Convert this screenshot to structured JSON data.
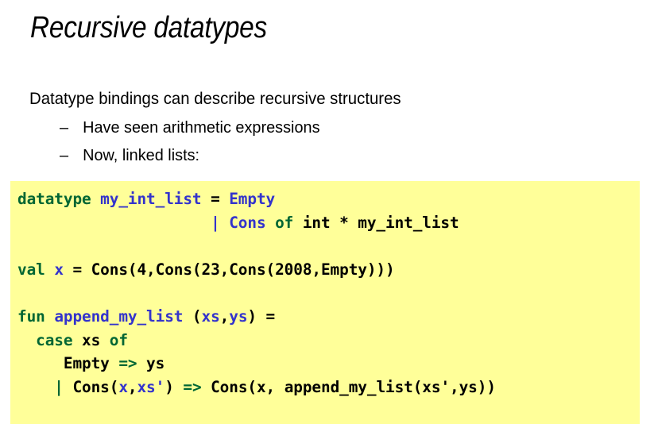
{
  "slide": {
    "title": "Recursive datatypes",
    "background_color": "#ffffff",
    "title_color": "#000000"
  },
  "bullets": {
    "level1": "Datatype bindings can describe recursive structures",
    "dash": "–",
    "level2": [
      "Have seen arithmetic expressions",
      "Now, linked lists:"
    ]
  },
  "code_block": {
    "background_color": "#ffff99",
    "keyword_color": "#006633",
    "constructor_color": "#3333cc",
    "plain_color": "#000000",
    "language": "Standard ML",
    "plain_text": "datatype my_int_list = Empty\n                     | Cons of int * my_int_list\n\nval x = Cons(4,Cons(23,Cons(2008,Empty)))\n\nfun append_my_list (xs,ys) =\n  case xs of\n     Empty => ys\n    | Cons(x,xs') => Cons(x, append_my_list(xs',ys))",
    "lines": [
      {
        "id": "line-datatype",
        "tokens": [
          {
            "text": "datatype",
            "style": "kw"
          },
          {
            "text": " ",
            "style": "plain"
          },
          {
            "text": "my_int_list",
            "style": "ctor"
          },
          {
            "text": " = ",
            "style": "plain"
          },
          {
            "text": "Empty",
            "style": "ctor"
          }
        ]
      },
      {
        "id": "line-cons-of",
        "tokens": [
          {
            "text": "                     ",
            "style": "plain"
          },
          {
            "text": "|",
            "style": "ctor"
          },
          {
            "text": " ",
            "style": "plain"
          },
          {
            "text": "Cons",
            "style": "ctor"
          },
          {
            "text": " ",
            "style": "plain"
          },
          {
            "text": "of",
            "style": "kw"
          },
          {
            "text": " int * my_int_list",
            "style": "plain"
          }
        ]
      },
      {
        "id": "line-blank-1",
        "tokens": []
      },
      {
        "id": "line-val-x",
        "tokens": [
          {
            "text": "val",
            "style": "kw"
          },
          {
            "text": " ",
            "style": "plain"
          },
          {
            "text": "x",
            "style": "ctor"
          },
          {
            "text": " = Cons(4,Cons(23,Cons(2008,Empty)))",
            "style": "plain"
          }
        ]
      },
      {
        "id": "line-blank-2",
        "tokens": []
      },
      {
        "id": "line-fun",
        "tokens": [
          {
            "text": "fun",
            "style": "kw"
          },
          {
            "text": " ",
            "style": "plain"
          },
          {
            "text": "append_my_list",
            "style": "ctor"
          },
          {
            "text": " (",
            "style": "plain"
          },
          {
            "text": "xs",
            "style": "ctor"
          },
          {
            "text": ",",
            "style": "plain"
          },
          {
            "text": "ys",
            "style": "ctor"
          },
          {
            "text": ") =",
            "style": "plain"
          }
        ]
      },
      {
        "id": "line-case",
        "tokens": [
          {
            "text": "  ",
            "style": "plain"
          },
          {
            "text": "case",
            "style": "kw"
          },
          {
            "text": " xs ",
            "style": "plain"
          },
          {
            "text": "of",
            "style": "kw"
          }
        ]
      },
      {
        "id": "line-empty-branch",
        "tokens": [
          {
            "text": "     Empty ",
            "style": "plain"
          },
          {
            "text": "=>",
            "style": "kw"
          },
          {
            "text": " ys",
            "style": "plain"
          }
        ]
      },
      {
        "id": "line-cons-branch",
        "tokens": [
          {
            "text": "    ",
            "style": "plain"
          },
          {
            "text": "|",
            "style": "kw"
          },
          {
            "text": " Cons(",
            "style": "plain"
          },
          {
            "text": "x",
            "style": "ctor"
          },
          {
            "text": ",",
            "style": "plain"
          },
          {
            "text": "xs'",
            "style": "ctor"
          },
          {
            "text": ") ",
            "style": "plain"
          },
          {
            "text": "=>",
            "style": "kw"
          },
          {
            "text": " Cons(x, append_my_list(xs',ys))",
            "style": "plain"
          }
        ]
      }
    ]
  }
}
